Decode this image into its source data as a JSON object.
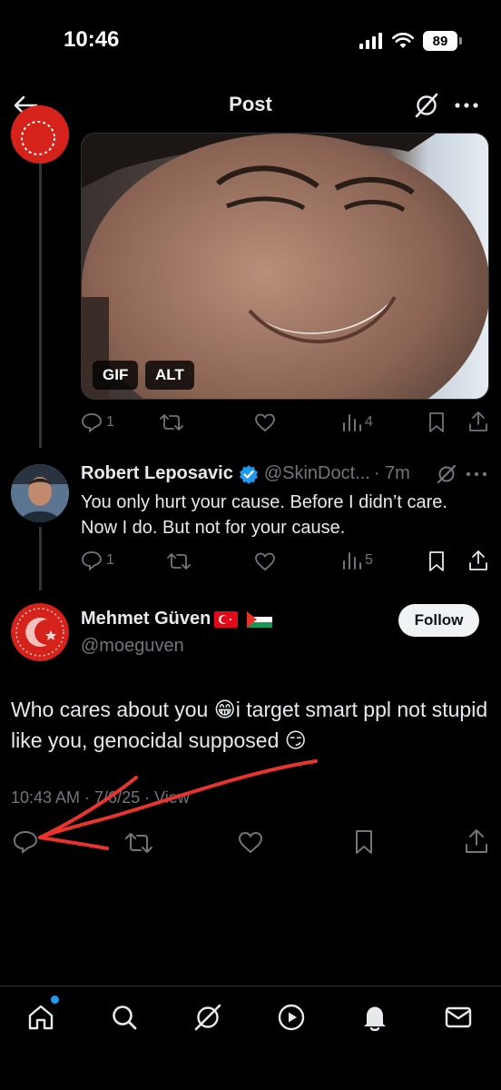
{
  "status_bar": {
    "time": "10:46",
    "battery": "89"
  },
  "header": {
    "title": "Post"
  },
  "media_post": {
    "gif_badge": "GIF",
    "alt_badge": "ALT",
    "actions": {
      "replies": "1",
      "reposts": "",
      "likes": "",
      "views": "4"
    }
  },
  "reply": {
    "name": "Robert Leposavic",
    "handle": "@SkinDoct...",
    "time": "· 7m",
    "text": "You only hurt your cause. Before I didn’t care. Now I do. But not for your cause.",
    "actions": {
      "replies": "1",
      "reposts": "",
      "likes": "",
      "views": "5"
    }
  },
  "main_post": {
    "name": "Mehmet Güven",
    "handle": "@moeguven",
    "follow_label": "Follow",
    "text": "Who cares about you 😁i target smart ppl not stupid like you, genocidal supposed 😏",
    "meta": "10:43 AM · 7/6/25 · View"
  },
  "colors": {
    "accent": "#1d9bf0",
    "annotation": "#e8332f",
    "muted": "#71767b"
  },
  "tabbar": {
    "items": [
      "home-icon",
      "search-icon",
      "grok-icon",
      "video-icon",
      "notifications-icon",
      "messages-icon"
    ]
  }
}
